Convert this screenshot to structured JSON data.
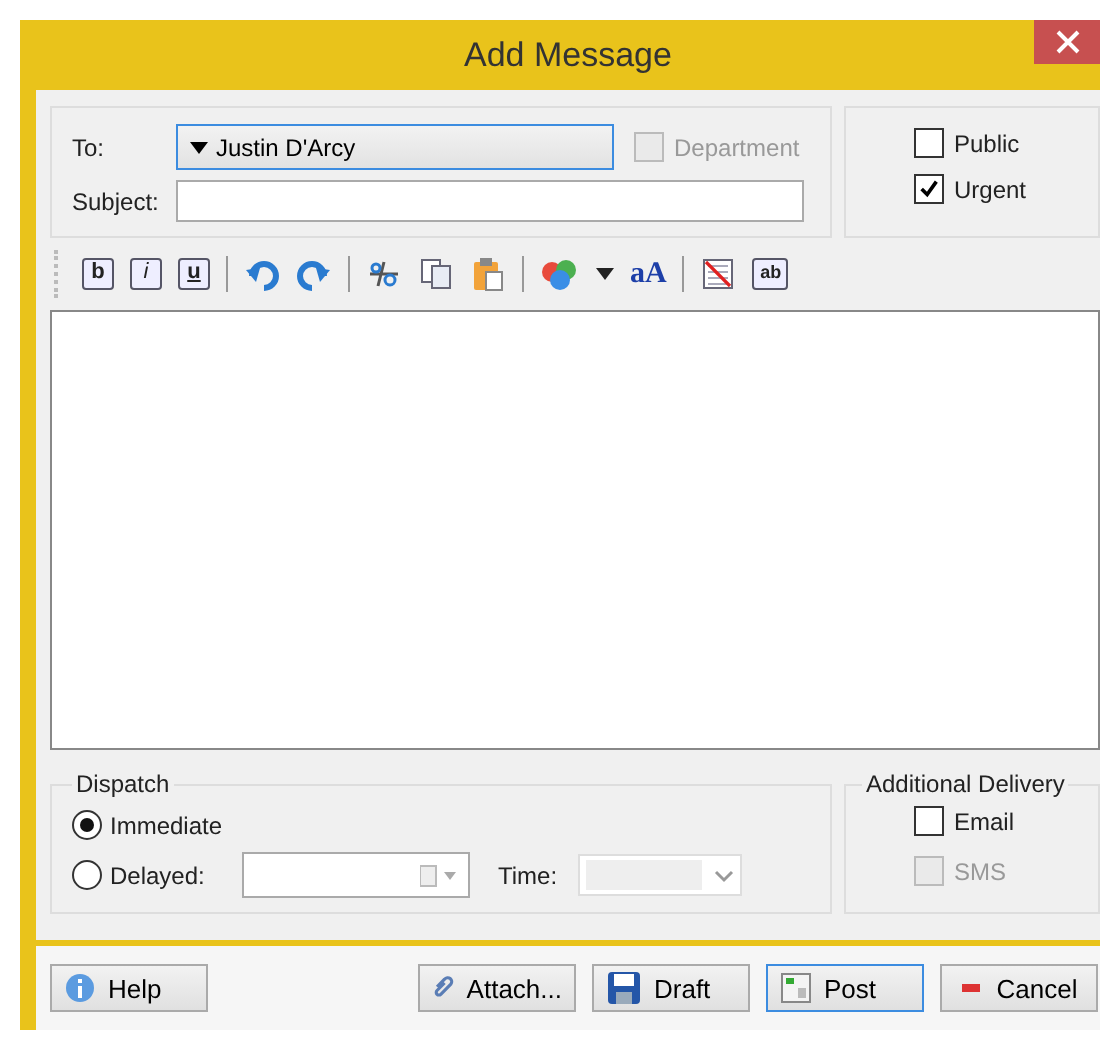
{
  "window": {
    "title": "Add Message"
  },
  "to": {
    "label": "To:",
    "value": "Justin D'Arcy"
  },
  "department": {
    "label": "Department",
    "checked": false,
    "disabled": true
  },
  "subject": {
    "label": "Subject:"
  },
  "flags": [
    {
      "label": "Public",
      "checked": false
    },
    {
      "label": "Urgent",
      "checked": true
    }
  ],
  "toolbar": [
    {
      "kind": "bold",
      "glyph": "b"
    },
    {
      "kind": "italic",
      "glyph": "i"
    },
    {
      "kind": "underline",
      "glyph": "u"
    },
    {
      "kind": "separator"
    },
    {
      "kind": "undo"
    },
    {
      "kind": "redo"
    },
    {
      "kind": "separator"
    },
    {
      "kind": "cut"
    },
    {
      "kind": "copy"
    },
    {
      "kind": "paste"
    },
    {
      "kind": "separator"
    },
    {
      "kind": "color"
    },
    {
      "kind": "caret"
    },
    {
      "kind": "font",
      "glyph": "aA"
    },
    {
      "kind": "separator"
    },
    {
      "kind": "clear"
    },
    {
      "kind": "spell",
      "glyph": "ab"
    }
  ],
  "dispatch": {
    "title": "Dispatch",
    "options": [
      {
        "label": "Immediate",
        "selected": true
      },
      {
        "label": "Delayed:",
        "selected": false
      }
    ],
    "time_label": "Time:"
  },
  "additional_delivery": {
    "title": "Additional Delivery",
    "options": [
      {
        "label": "Email",
        "checked": false,
        "disabled": false
      },
      {
        "label": "SMS",
        "checked": false,
        "disabled": true
      }
    ]
  },
  "buttons": [
    {
      "kind": "help",
      "label": "Help",
      "default": false
    },
    {
      "kind": "attach",
      "label": "Attach...",
      "default": false
    },
    {
      "kind": "draft",
      "label": "Draft",
      "default": false
    },
    {
      "kind": "post",
      "label": "Post",
      "default": true
    },
    {
      "kind": "cancel",
      "label": "Cancel",
      "default": false
    }
  ]
}
